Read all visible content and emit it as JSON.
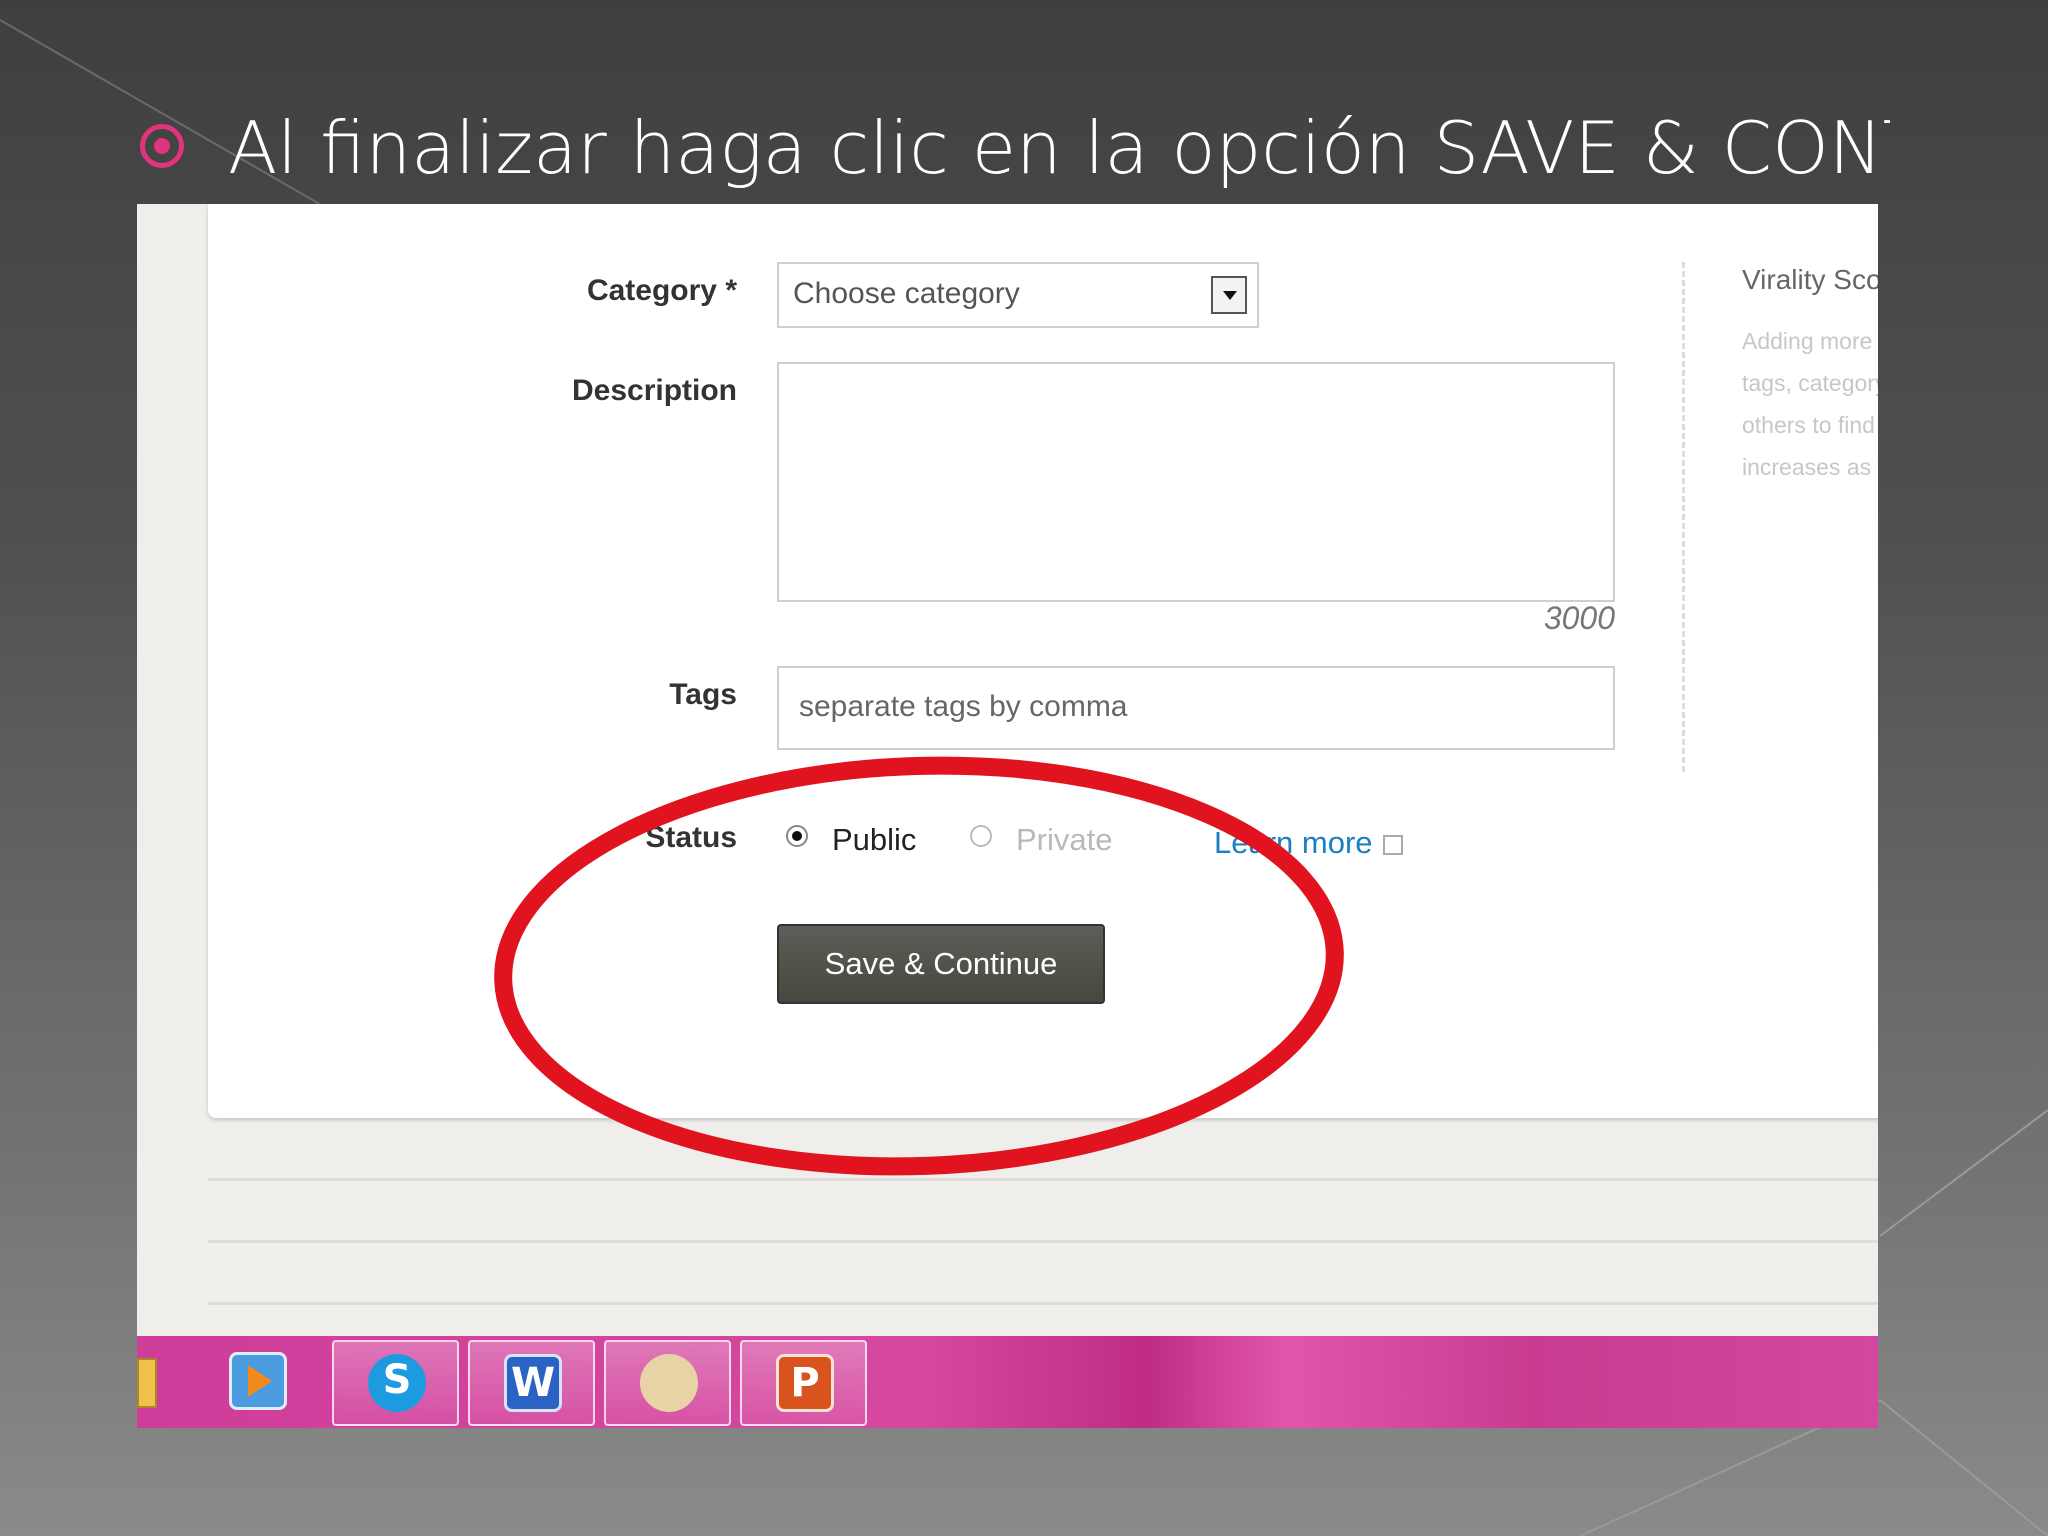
{
  "slide": {
    "title": "Al finalizar haga clic en la opción SAVE & CONTINUE"
  },
  "form": {
    "category_label": "Category *",
    "category_value": "Choose category",
    "description_label": "Description",
    "char_limit": "3000",
    "tags_label": "Tags",
    "tags_placeholder": "separate tags by comma",
    "status_label": "Status",
    "status_options": [
      {
        "label": "Public",
        "selected": true
      },
      {
        "label": "Private",
        "selected": false
      }
    ],
    "learn_more": "Learn more",
    "save_label": "Save & Continue"
  },
  "virality": {
    "title": "Virality Score",
    "description": [
      "Adding more inform",
      "tags, category) ma",
      "others to find your",
      "increases as you a"
    ]
  },
  "taskbar": {
    "apps": [
      "folder-icon",
      "media-player-icon",
      "skype-icon",
      "word-icon",
      "paint-icon",
      "powerpoint-icon"
    ]
  },
  "colors": {
    "bullet": "#e2337f",
    "highlight": "#e0131f",
    "link": "#1b7fc4",
    "button": "#505049",
    "taskbar": "#d6489f"
  }
}
